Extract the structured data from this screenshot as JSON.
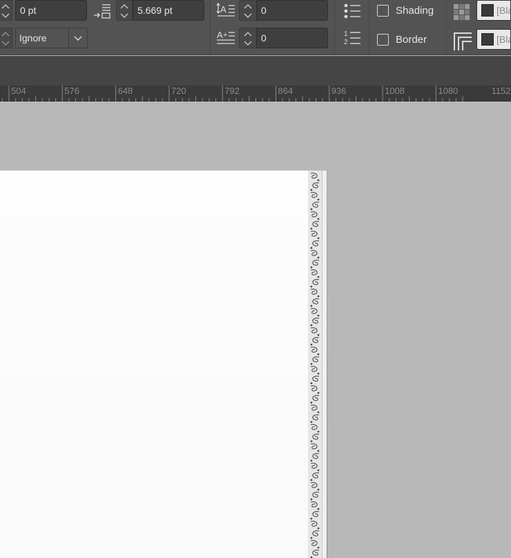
{
  "control_panel": {
    "left_indent_value": "0 pt",
    "space_after_value": "5.669 pt",
    "align_to_grid_value": "Ignore",
    "drop_cap_lines_value": "0",
    "drop_cap_chars_value": "0",
    "shading_label": "Shading",
    "border_label": "Border",
    "shading_swatch_text": "[Bla",
    "border_swatch_text": "[Bla"
  },
  "ruler": {
    "labels": [
      "504",
      "576",
      "648",
      "720",
      "792",
      "864",
      "936",
      "1008",
      "1080",
      "1152"
    ]
  },
  "colors": {
    "panel_bg": "#535353",
    "pasteboard": "#b8b8b8",
    "page": "#fcfcfc",
    "ruler_bg": "#3a3a3a"
  },
  "icons": [
    "spinner-arrows-icon",
    "space-after-icon",
    "drop-cap-lines-icon",
    "drop-cap-chars-icon",
    "bullets-icon",
    "numbering-icon",
    "shading-icon",
    "border-icon",
    "chevron-down-icon"
  ]
}
